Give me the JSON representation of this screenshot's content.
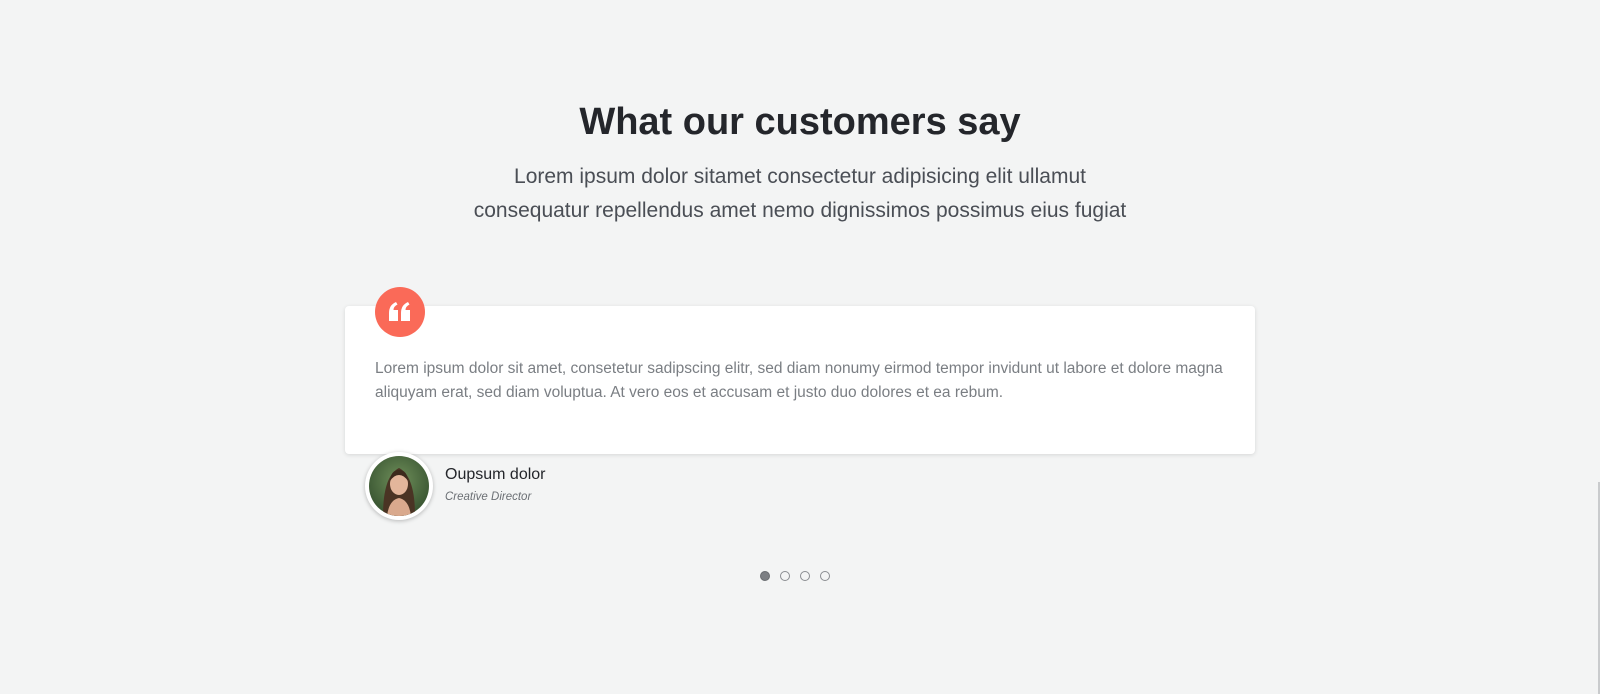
{
  "section": {
    "title": "What our customers say",
    "subtitle_lines": [
      "Lorem ipsum dolor sitamet consectetur adipisicing elit ullamut",
      "consequatur repellendus amet nemo dignissimos possimus eius fugiat"
    ]
  },
  "testimonial": {
    "quote_icon": "quote-icon",
    "text": "Lorem ipsum dolor sit amet, consetetur sadipscing elitr, sed diam nonumy eirmod tempor invidunt ut labore et dolore magna aliquyam erat, sed diam voluptua. At vero eos et accusam et justo duo dolores et ea rebum.",
    "author": {
      "name": "Oupsum dolor",
      "role": "Creative Director"
    }
  },
  "carousel": {
    "total_slides": 4,
    "active_index": 0
  },
  "colors": {
    "background": "#f3f4f4",
    "accent": "#fa6a58",
    "heading": "#24262b",
    "body_text": "#7a7e83"
  }
}
